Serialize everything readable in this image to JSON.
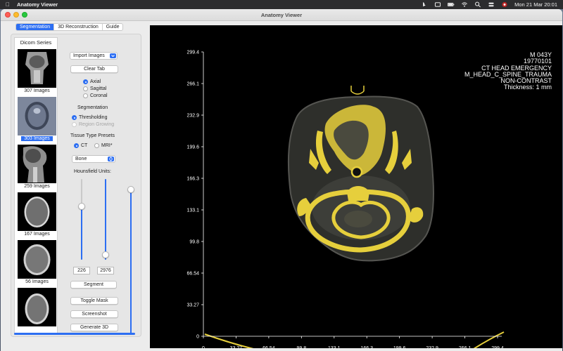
{
  "menubar": {
    "app_name": "Anatomy Viewer",
    "datetime": "Mon 21 Mar  20:01",
    "icons": [
      "apple-icon",
      "bing-icon",
      "window-icon",
      "battery-icon",
      "wifi-icon",
      "search-icon",
      "control-center-icon",
      "flag-icon"
    ]
  },
  "window": {
    "title": "Anatomy Viewer"
  },
  "tabs": [
    {
      "label": "Segmentation",
      "active": true
    },
    {
      "label": "3D Reconstruction",
      "active": false
    },
    {
      "label": "Guide",
      "active": false
    }
  ],
  "series": {
    "title": "Dicom Series",
    "items": [
      {
        "caption": "307 Images",
        "selected": false
      },
      {
        "caption": "303 Images",
        "selected": true
      },
      {
        "caption": "259 Images",
        "selected": false
      },
      {
        "caption": "167 Images",
        "selected": false
      },
      {
        "caption": "56 Images",
        "selected": false
      },
      {
        "caption": "",
        "selected": false
      }
    ]
  },
  "controls": {
    "import_label": "Import Images",
    "clear_tab": "Clear Tab",
    "orientation": [
      "Axial",
      "Sagittal",
      "Coronal"
    ],
    "orientation_selected": "Axial",
    "segmentation_heading": "Segmentation",
    "segmentation_methods": [
      "Thresholding",
      "Region Growing"
    ],
    "tissue_heading": "Tissue Type Presets",
    "modality": [
      "CT",
      "MRI*"
    ],
    "modality_selected": "CT",
    "preset_value": "Bone",
    "hu_heading": "Hounsfield Units:",
    "hu_min": "226",
    "hu_max": "2976",
    "segment": "Segment",
    "toggle_mask": "Toggle Mask",
    "screenshot": "Screenshot",
    "generate_3d": "Generate 3D"
  },
  "viewer": {
    "info_lines": [
      "M  043Y",
      "19770101",
      "CT  HEAD EMERGENCY",
      "M_HEAD_C_SPINE_TRAUMA",
      "NON-CONTRAST",
      "Thickness: 1 mm"
    ],
    "y_ticks": [
      "299.4",
      "266.1",
      "232.9",
      "199.6",
      "166.3",
      "133.1",
      "99.8",
      "66.54",
      "33.27",
      "0"
    ],
    "x_ticks": [
      "0",
      "33.27",
      "66.54",
      "99.8",
      "133.1",
      "166.3",
      "199.6",
      "232.9",
      "266.1",
      "299.4"
    ],
    "mask_color": "#e6cf3c"
  }
}
